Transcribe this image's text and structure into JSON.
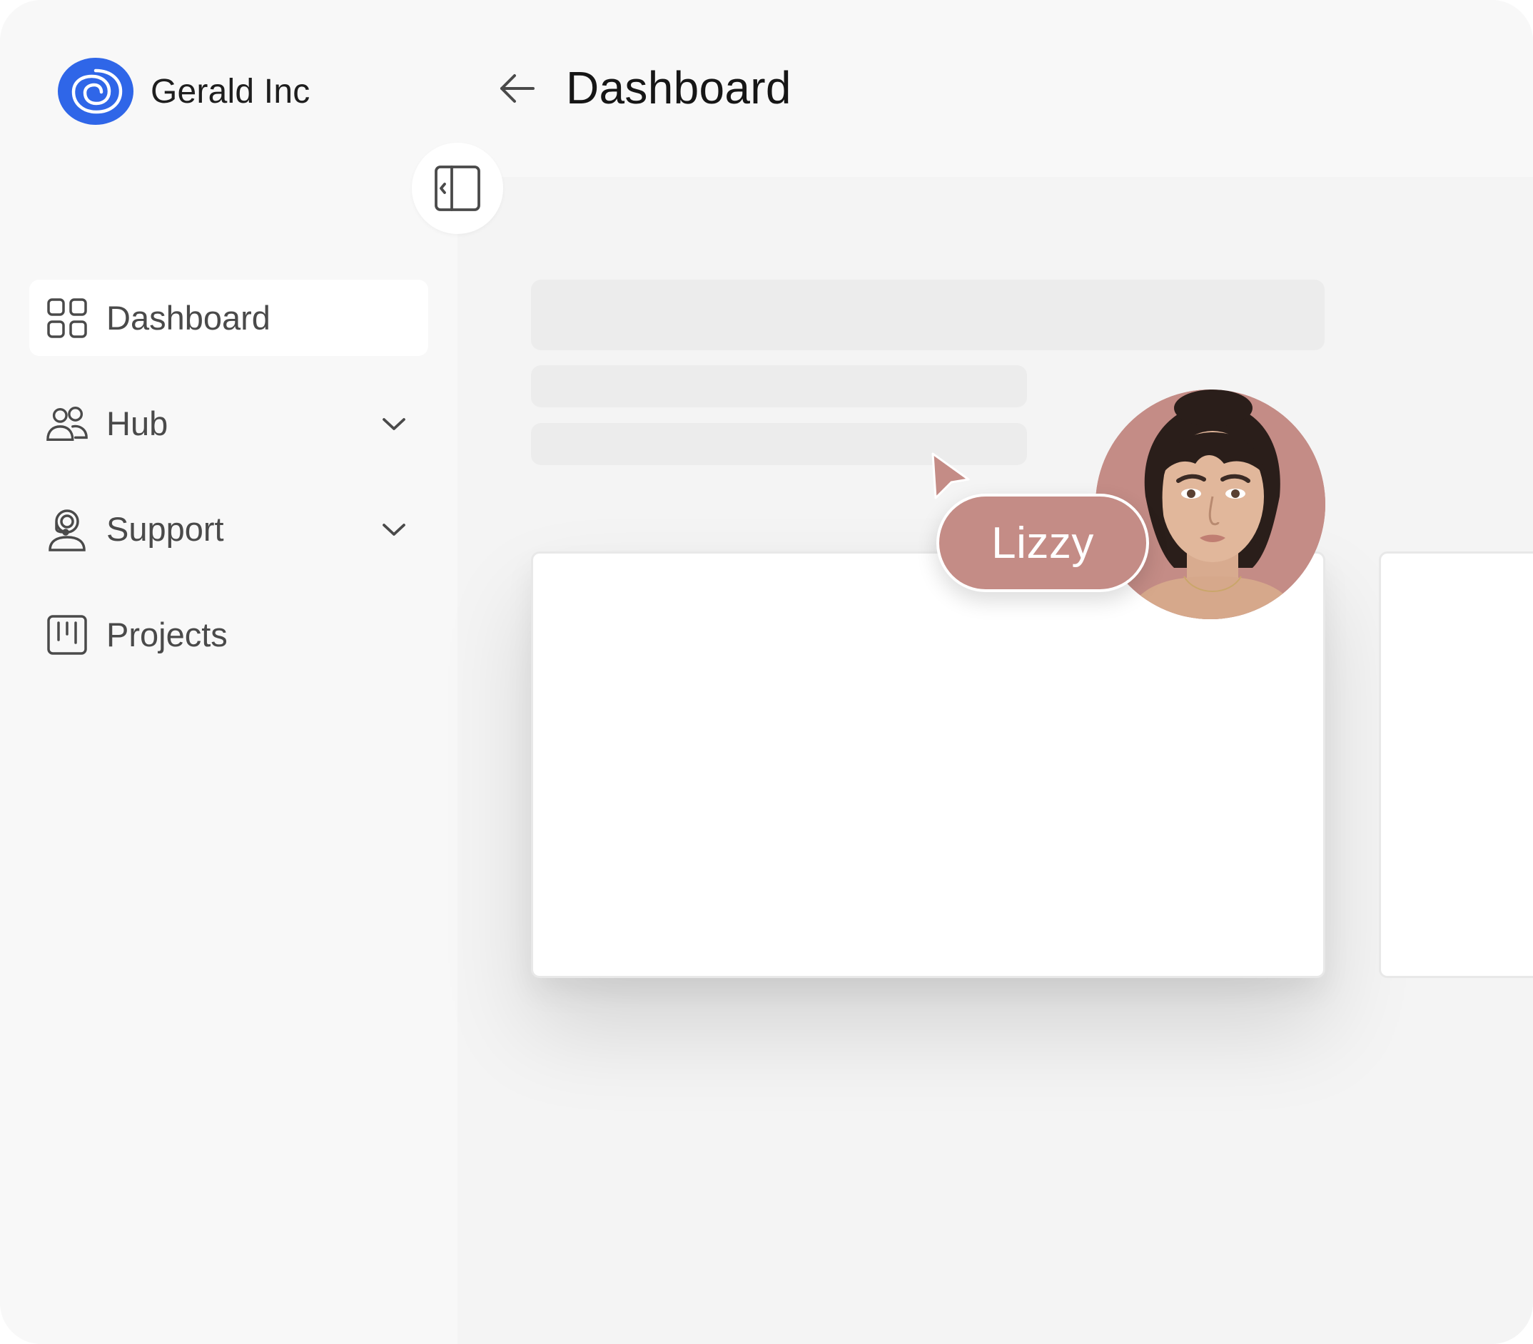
{
  "brand": {
    "name": "Gerald Inc",
    "logo_icon": "spiral-logo-icon",
    "logo_color": "#2f66e8"
  },
  "sidebar": {
    "collapse_icon": "sidebar-collapse-icon",
    "items": [
      {
        "label": "Dashboard",
        "icon": "grid-icon",
        "active": true,
        "has_chevron": false
      },
      {
        "label": "Hub",
        "icon": "users-icon",
        "active": false,
        "has_chevron": true
      },
      {
        "label": "Support",
        "icon": "support-agent-icon",
        "active": false,
        "has_chevron": true
      },
      {
        "label": "Projects",
        "icon": "kanban-icon",
        "active": false,
        "has_chevron": false
      }
    ]
  },
  "header": {
    "back_icon": "arrow-left-icon",
    "title": "Dashboard"
  },
  "collaborator": {
    "name": "Lizzy",
    "color": "#c48c86",
    "cursor_icon": "cursor-pointer-icon"
  },
  "colors": {
    "accent": "#2f66e8",
    "text": "#161616",
    "muted_text": "#4a4a4a"
  }
}
